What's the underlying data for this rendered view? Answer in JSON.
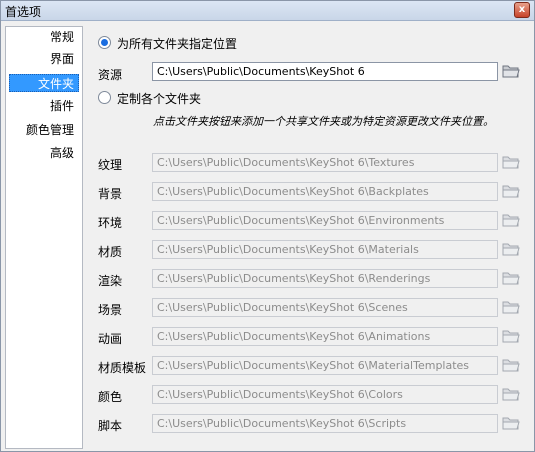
{
  "window": {
    "title": "首选项",
    "close_glyph": "x"
  },
  "sidebar": {
    "items": [
      {
        "label": "常规",
        "selected": false
      },
      {
        "label": "界面",
        "selected": false
      },
      {
        "label": "文件夹",
        "selected": true
      },
      {
        "label": "插件",
        "selected": false
      },
      {
        "label": "颜色管理",
        "selected": false
      },
      {
        "label": "高级",
        "selected": false
      }
    ]
  },
  "folders": {
    "option_all": "为所有文件夹指定位置",
    "option_all_checked": true,
    "resources_label": "资源",
    "resources_path": "C:\\Users\\Public\\Documents\\KeyShot 6",
    "option_custom": "定制各个文件夹",
    "option_custom_checked": false,
    "hint": "点击文件夹按钮来添加一个共享文件夹或为特定资源更改文件夹位置。",
    "rows": [
      {
        "label": "纹理",
        "path": "C:\\Users\\Public\\Documents\\KeyShot 6\\Textures"
      },
      {
        "label": "背景",
        "path": "C:\\Users\\Public\\Documents\\KeyShot 6\\Backplates"
      },
      {
        "label": "环境",
        "path": "C:\\Users\\Public\\Documents\\KeyShot 6\\Environments"
      },
      {
        "label": "材质",
        "path": "C:\\Users\\Public\\Documents\\KeyShot 6\\Materials"
      },
      {
        "label": "渲染",
        "path": "C:\\Users\\Public\\Documents\\KeyShot 6\\Renderings"
      },
      {
        "label": "场景",
        "path": "C:\\Users\\Public\\Documents\\KeyShot 6\\Scenes"
      },
      {
        "label": "动画",
        "path": "C:\\Users\\Public\\Documents\\KeyShot 6\\Animations"
      },
      {
        "label": "材质模板",
        "path": "C:\\Users\\Public\\Documents\\KeyShot 6\\MaterialTemplates"
      },
      {
        "label": "颜色",
        "path": "C:\\Users\\Public\\Documents\\KeyShot 6\\Colors"
      },
      {
        "label": "脚本",
        "path": "C:\\Users\\Public\\Documents\\KeyShot 6\\Scripts"
      }
    ]
  },
  "icons": {
    "folder": "folder-icon",
    "close": "close-icon"
  },
  "colors": {
    "accent": "#3399ff",
    "radio_dot": "#1a6de0"
  }
}
